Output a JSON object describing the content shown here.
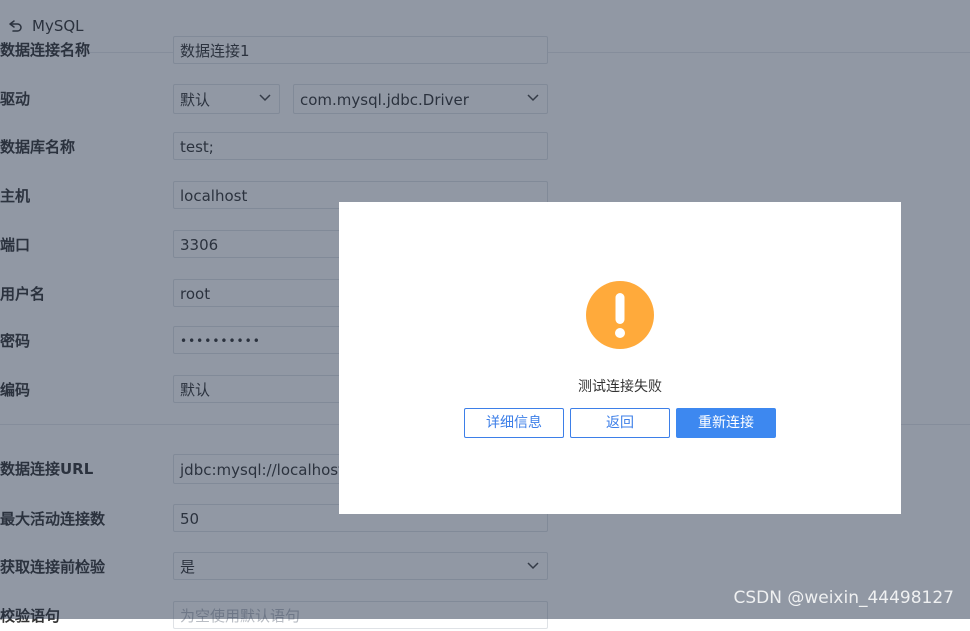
{
  "header": {
    "title": "MySQL",
    "back_icon": "back-arrow-icon"
  },
  "form": {
    "rows": [
      {
        "label": "数据连接名称",
        "value": "数据连接1"
      },
      {
        "label": "驱动",
        "value": "默认",
        "value2": "com.mysql.jdbc.Driver"
      },
      {
        "label": "数据库名称",
        "value": "test;"
      },
      {
        "label": "主机",
        "value": "localhost"
      },
      {
        "label": "端口",
        "value": "3306"
      },
      {
        "label": "用户名",
        "value": "root"
      },
      {
        "label": "密码",
        "value": "••••••••••"
      },
      {
        "label": "编码",
        "value": "默认"
      },
      {
        "label": "数据连接URL",
        "value": "jdbc:mysql://localhost:"
      },
      {
        "label": "最大活动连接数",
        "value": "50"
      },
      {
        "label": "获取连接前检验",
        "value": "是"
      },
      {
        "label": "校验语句",
        "placeholder": "为空使用默认语句"
      }
    ]
  },
  "dialog": {
    "icon": "warning-icon",
    "message": "测试连接失败",
    "buttons": {
      "details": "详细信息",
      "back": "返回",
      "reconnect": "重新连接"
    },
    "colors": {
      "warning": "#ffaa3b",
      "primary": "#3d88f0"
    }
  },
  "watermark": "CSDN @weixin_44498127"
}
